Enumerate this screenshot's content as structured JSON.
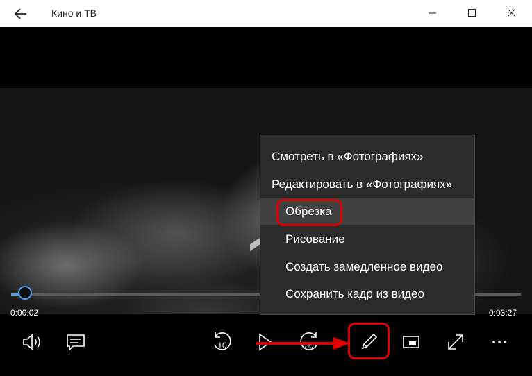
{
  "window": {
    "title": "Кино и ТВ"
  },
  "player": {
    "current_time": "0:00:02",
    "total_time": "0:03:27",
    "progress_fraction": 0.01,
    "rewind_seconds": "10",
    "forward_seconds": "30"
  },
  "context_menu": {
    "items": [
      {
        "label": "Смотреть в «Фотографиях»"
      },
      {
        "label": "Редактировать в «Фотографиях»"
      },
      {
        "label": "Обрезка"
      },
      {
        "label": "Рисование"
      },
      {
        "label": "Создать замедленное видео"
      },
      {
        "label": "Сохранить кадр из видео"
      }
    ],
    "highlighted_index": 2
  },
  "controls": {
    "left": [
      "volume-icon",
      "subtitles-icon"
    ],
    "right": [
      "rewind-10-icon",
      "play-icon",
      "forward-30-icon",
      "edit-pen-icon",
      "mini-view-icon",
      "fullscreen-icon",
      "more-icon"
    ]
  },
  "colors": {
    "accent": "#4aa0e6",
    "annotation": "#e00000",
    "menu_bg": "#2b2b2b",
    "menu_highlight": "#414141"
  }
}
